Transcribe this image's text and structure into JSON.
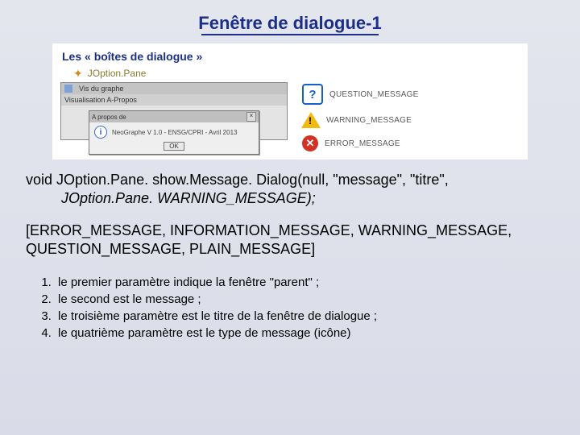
{
  "title": "Fenêtre de dialogue-1",
  "visual": {
    "header": "Les « boîtes de dialogue »",
    "sub": "JOption.Pane",
    "outerWin": {
      "menu1": "Vis du graphe",
      "menu2": "Visualisation   A-Propos"
    },
    "dialog": {
      "title": "A propos de",
      "msg": "NeoGraphe V 1.0 - ENSG/CPRI - Avril 2013",
      "ok": "OK"
    },
    "iconLabels": {
      "question": "QUESTION_MESSAGE",
      "warning": "WARNING_MESSAGE",
      "error": "ERROR_MESSAGE"
    }
  },
  "code": {
    "l1a": "void JOption.Pane. show.Message. Dialog(null, \"message\", \"titre\",",
    "l2a": "JOption.Pane. WARNING_MESSAGE);"
  },
  "enum": "[ERROR_MESSAGE, INFORMATION_MESSAGE, WARNING_MESSAGE, QUESTION_MESSAGE, PLAIN_MESSAGE]",
  "params": [
    "le premier paramètre indique la fenêtre \"parent\" ;",
    "le second est le message ;",
    "le troisième paramètre est le titre de la fenêtre de dialogue ;",
    "le quatrième paramètre est le type de message (icône)"
  ]
}
